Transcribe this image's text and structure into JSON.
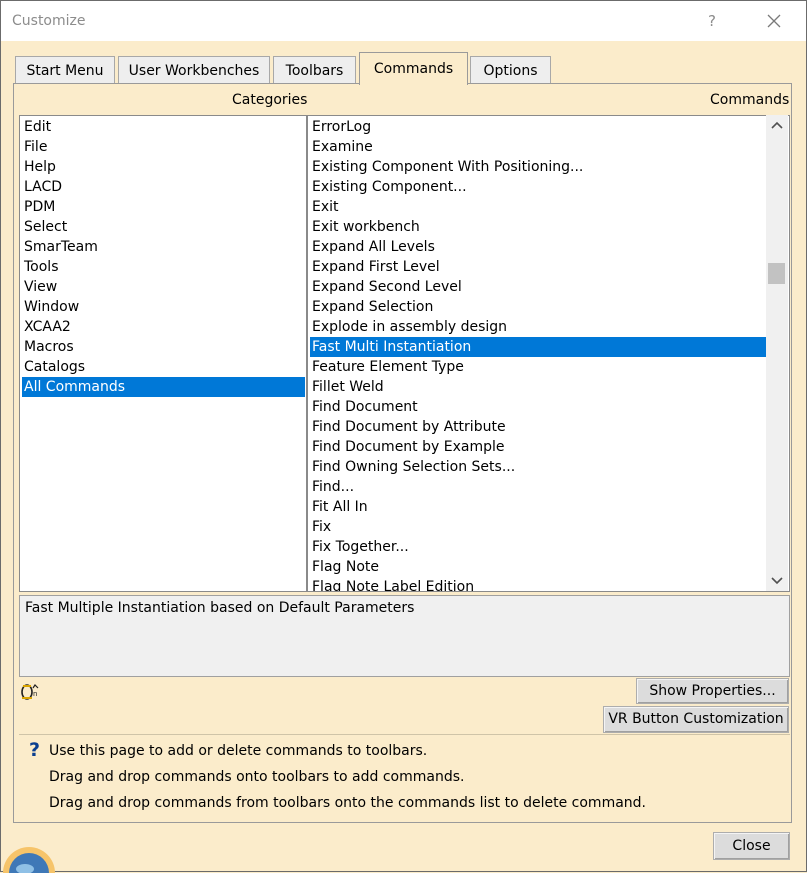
{
  "window": {
    "title": "Customize",
    "help_glyph": "?"
  },
  "tabs": [
    {
      "label": "Start Menu"
    },
    {
      "label": "User Workbenches"
    },
    {
      "label": "Toolbars"
    },
    {
      "label": "Commands",
      "active": true
    },
    {
      "label": "Options"
    }
  ],
  "categories": {
    "header": "Categories",
    "items": [
      "Edit",
      "File",
      "Help",
      "LACD",
      "PDM",
      "Select",
      "SmarTeam",
      "Tools",
      "View",
      "Window",
      "XCAA2",
      "Macros",
      "Catalogs",
      "All Commands"
    ],
    "selected": "All Commands"
  },
  "commands": {
    "header": "Commands",
    "items": [
      "ErrorLog",
      "Examine",
      "Existing Component With Positioning...",
      "Existing Component...",
      "Exit",
      "Exit workbench",
      "Expand All Levels",
      "Expand First Level",
      "Expand Second Level",
      "Expand Selection",
      "Explode in assembly design",
      "Fast Multi Instantiation",
      "Feature Element Type",
      "Fillet Weld",
      "Find Document",
      "Find Document by Attribute",
      "Find Document by Example",
      "Find Owning Selection Sets...",
      "Find...",
      "Fit All In",
      "Fix",
      "Fix Together...",
      "Flag Note",
      "Flag Note Label Edition"
    ],
    "selected": "Fast Multi Instantiation"
  },
  "description": "Fast Multiple Instantiation based on Default Parameters",
  "buttons": {
    "show_properties": "Show Properties...",
    "vr_button": "VR Button Customization",
    "close": "Close"
  },
  "info": {
    "line1": "Use this page to add or delete commands to toolbars.",
    "line2": "Drag and drop commands onto toolbars to add commands.",
    "line3": "Drag and drop commands from toolbars onto the commands list to delete command."
  },
  "icons": {
    "title_help": "help-icon",
    "title_close": "close-icon",
    "command_icon": "fast-multi-instantiation-icon",
    "info": "question-mark-icon",
    "scroll_up": "chevron-up-icon",
    "scroll_down": "chevron-down-icon"
  },
  "colors": {
    "selection": "#0078d7",
    "dialog_bg": "#fbeccb",
    "info_icon": "#0b3f8f"
  }
}
